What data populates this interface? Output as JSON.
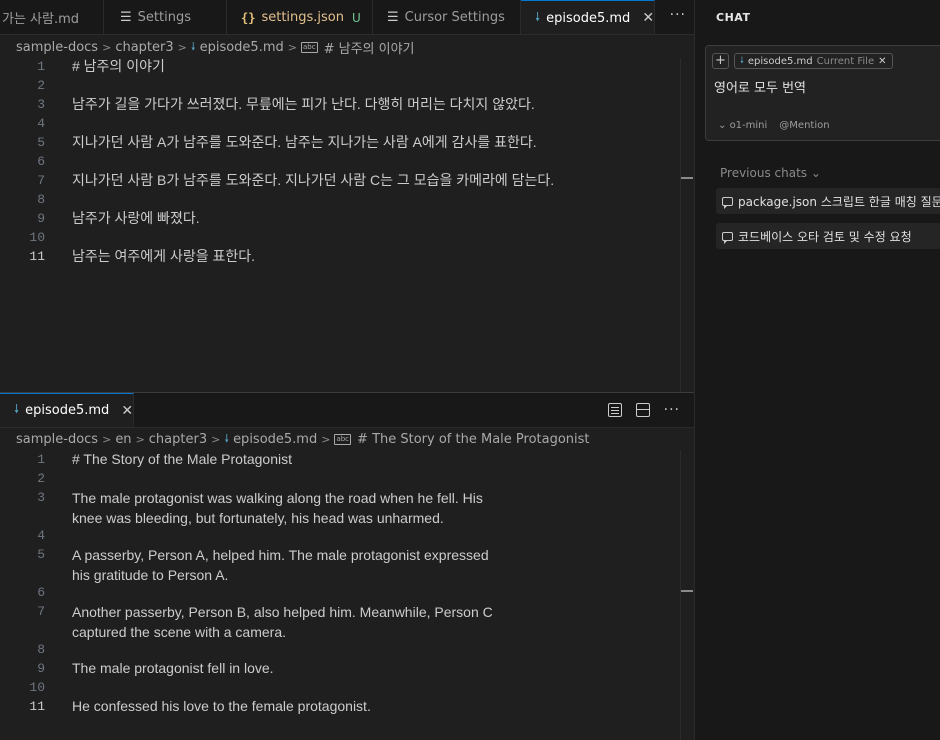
{
  "tabs_top": [
    {
      "label": "가는 사람.md",
      "icon": "markdown-icon"
    },
    {
      "label": "Settings",
      "icon": "gear-icon"
    },
    {
      "label": "settings.json",
      "badge": "U",
      "icon": "json-icon"
    },
    {
      "label": "Cursor Settings",
      "icon": "gear-icon"
    },
    {
      "label": "episode5.md",
      "icon": "markdown-icon",
      "active": true
    }
  ],
  "breadcrumb_top": {
    "parts": [
      "sample-docs",
      "chapter3",
      "episode5.md",
      "# 남주의 이야기"
    ]
  },
  "editor_top": {
    "lines": [
      {
        "n": "1",
        "text": "# 남주의 이야기"
      },
      {
        "n": "2",
        "text": ""
      },
      {
        "n": "3",
        "text": "남주가 길을 가다가 쓰러졌다. 무릎에는 피가 난다. 다행히 머리는 다치지 않았다."
      },
      {
        "n": "4",
        "text": ""
      },
      {
        "n": "5",
        "text": "지나가던 사람 A가 남주를 도와준다. 남주는 지나가는 사람 A에게 감사를 표한다."
      },
      {
        "n": "6",
        "text": ""
      },
      {
        "n": "7",
        "text": "지나가던 사람 B가 남주를 도와준다. 지나가던 사람 C는 그 모습을 카메라에 담는다."
      },
      {
        "n": "8",
        "text": ""
      },
      {
        "n": "9",
        "text": "남주가 사랑에 빠졌다."
      },
      {
        "n": "10",
        "text": ""
      },
      {
        "n": "11",
        "text": "남주는 여주에게 사랑을 표한다."
      }
    ]
  },
  "tab_bottom": {
    "label": "episode5.md"
  },
  "breadcrumb_bottom": {
    "parts": [
      "sample-docs",
      "en",
      "chapter3",
      "episode5.md",
      "# The Story of the Male Protagonist"
    ]
  },
  "editor_bottom": {
    "lines": [
      {
        "n": "1",
        "text": "# The Story of the Male Protagonist"
      },
      {
        "n": "2",
        "text": ""
      },
      {
        "n": "3",
        "text": "The male protagonist was walking along the road when he fell. His",
        "cont": "knee was bleeding, but fortunately, his head was unharmed."
      },
      {
        "n": "4",
        "text": ""
      },
      {
        "n": "5",
        "text": "A passerby, Person A, helped him. The male protagonist expressed",
        "cont": "his gratitude to Person A."
      },
      {
        "n": "6",
        "text": ""
      },
      {
        "n": "7",
        "text": "Another passerby, Person B, also helped him. Meanwhile, Person C",
        "cont": "captured the scene with a camera."
      },
      {
        "n": "8",
        "text": ""
      },
      {
        "n": "9",
        "text": "The male protagonist fell in love."
      },
      {
        "n": "10",
        "text": ""
      },
      {
        "n": "11",
        "text": "He confessed his love to the female protagonist."
      }
    ]
  },
  "chat": {
    "title": "CHAT",
    "chip_file": "episode5.md",
    "chip_tag": "Current File",
    "input_text": "영어로 모두 번역",
    "model": "o1-mini",
    "mention": "Mention",
    "previous_title": "Previous chats",
    "previous": [
      "package.json 스크립트 한글 매칭 질문",
      "코드베이스 오타 검토 및 수정 요청"
    ]
  }
}
